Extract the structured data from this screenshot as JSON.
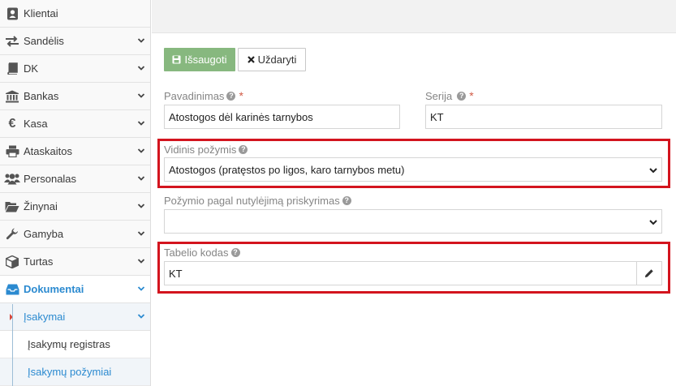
{
  "sidebar": {
    "items": [
      {
        "label": "Klientai",
        "icon": "contact-card-icon",
        "chevron": false
      },
      {
        "label": "Sandėlis",
        "icon": "exchange-arrows-icon",
        "chevron": true
      },
      {
        "label": "DK",
        "icon": "book-icon",
        "chevron": true
      },
      {
        "label": "Bankas",
        "icon": "bank-icon",
        "chevron": true
      },
      {
        "label": "Kasa",
        "icon": "euro-icon",
        "chevron": true
      },
      {
        "label": "Ataskaitos",
        "icon": "printer-icon",
        "chevron": true
      },
      {
        "label": "Personalas",
        "icon": "users-icon",
        "chevron": true
      },
      {
        "label": "Žinynai",
        "icon": "folder-open-icon",
        "chevron": true
      },
      {
        "label": "Gamyba",
        "icon": "wrench-icon",
        "chevron": true
      },
      {
        "label": "Turtas",
        "icon": "cube-icon",
        "chevron": true
      },
      {
        "label": "Dokumentai",
        "icon": "inbox-icon",
        "chevron": true,
        "active": true
      }
    ],
    "submenu_label": "Įsakymai",
    "leaves": [
      "Įsakymų registras",
      "Įsakymų požymiai"
    ]
  },
  "toolbar": {
    "save_label": "Išsaugoti",
    "close_label": "Uždaryti"
  },
  "form": {
    "name_label": "Pavadinimas",
    "name_value": "Atostogos dėl karinės tarnybos",
    "series_label": "Serija",
    "series_value": "KT",
    "internal_label": "Vidinis požymis",
    "internal_value": "Atostogos (pratęstos po ligos, karo tarnybos metu)",
    "default_label": "Požymio pagal nutylėjimą priskyrimas",
    "default_value": "",
    "timesheet_label": "Tabelio kodas",
    "timesheet_value": "KT",
    "required_mark": "*",
    "help_mark": "?"
  },
  "colors": {
    "accent": "#2b8ad0",
    "save_button": "#87b87f",
    "highlight_border": "#d3141e",
    "required": "#d15b47"
  }
}
